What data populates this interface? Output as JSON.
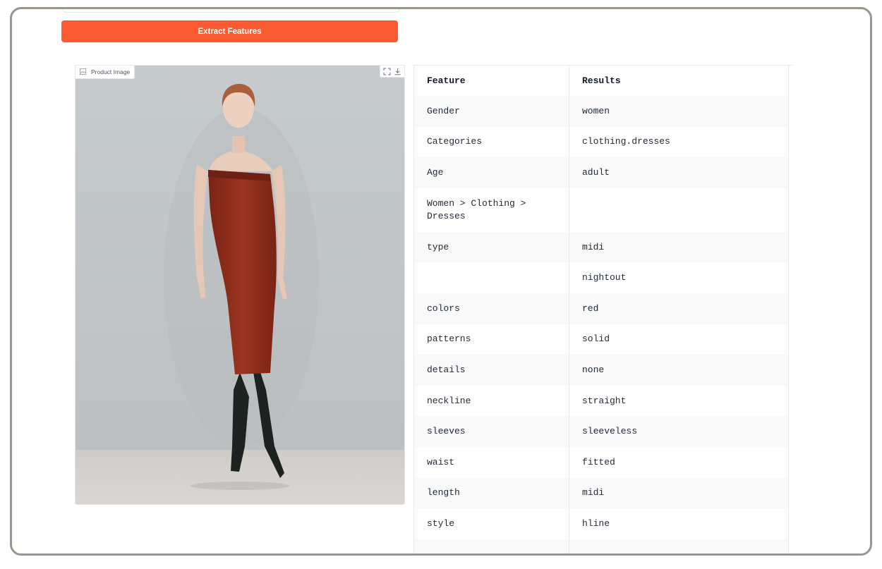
{
  "extract_button": {
    "label": "Extract Features"
  },
  "image_panel": {
    "label": "Product Image"
  },
  "table": {
    "headers": [
      "Feature",
      "Results"
    ],
    "rows": [
      [
        "Gender",
        "women"
      ],
      [
        "Categories",
        "clothing.dresses"
      ],
      [
        "Age",
        "adult"
      ],
      [
        "Women > Clothing > Dresses",
        ""
      ],
      [
        "type",
        "midi"
      ],
      [
        "",
        "nightout"
      ],
      [
        "colors",
        "red"
      ],
      [
        "patterns",
        "solid"
      ],
      [
        "details",
        "none"
      ],
      [
        "neckline",
        "straight"
      ],
      [
        "sleeves",
        "sleeveless"
      ],
      [
        "waist",
        "fitted"
      ],
      [
        "length",
        "midi"
      ],
      [
        "style",
        "hline"
      ],
      [
        "",
        ""
      ]
    ]
  },
  "colors": {
    "accent": "#fa5a32",
    "frame": "#9c958e",
    "dress": "#8e2d1b"
  },
  "icons": [
    "image-icon",
    "fullscreen-icon",
    "download-icon"
  ]
}
